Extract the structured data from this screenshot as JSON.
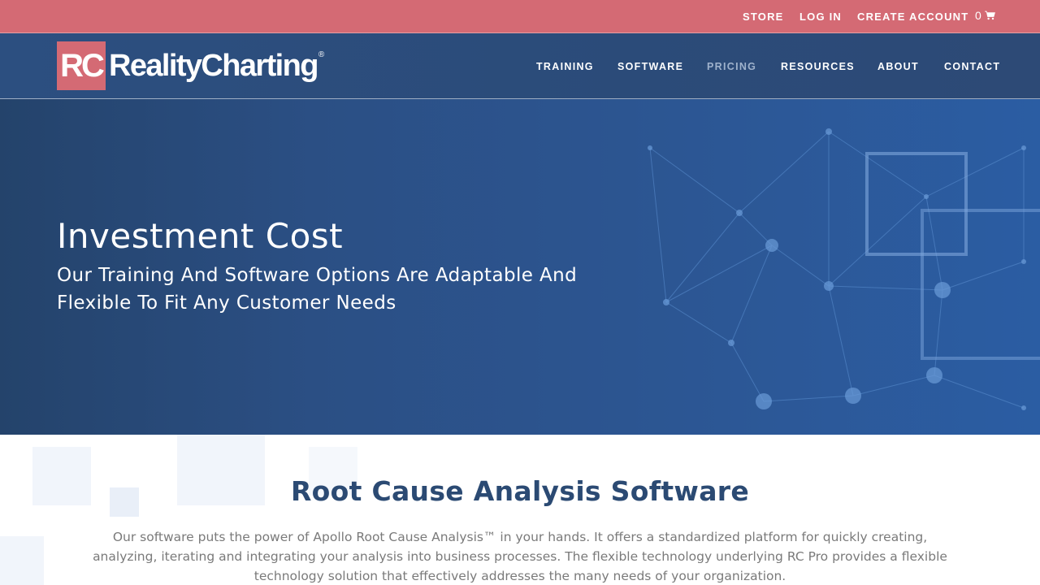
{
  "topbar": {
    "links": [
      "STORE",
      "LOG IN",
      "CREATE ACCOUNT"
    ],
    "cart_count": "0",
    "cart_icon": "shopping-cart-icon",
    "background": "#d46a74"
  },
  "header": {
    "logo_mark": "RC",
    "logo_text": "RealityCharting",
    "logo_reg": "®",
    "nav": [
      "TRAINING",
      "SOFTWARE",
      "PRICING",
      "RESOURCES",
      "ABOUT",
      "CONTACT"
    ],
    "active_nav": "PRICING",
    "background": "#2c4f80"
  },
  "hero": {
    "title": "Investment Cost",
    "subtitle": "Our Training And Software Options Are Adaptable And Flexible To Fit Any Customer Needs"
  },
  "main": {
    "section_title": "Root Cause Analysis Software",
    "body": "Our software puts the power of Apollo Root Cause Analysis™ in your hands. It offers a standardized platform for quickly creating, analyzing, iterating and integrating your analysis into business processes. The flexible technology underlying RC Pro provides a flexible technology solution that effectively addresses the many needs of your organization."
  }
}
